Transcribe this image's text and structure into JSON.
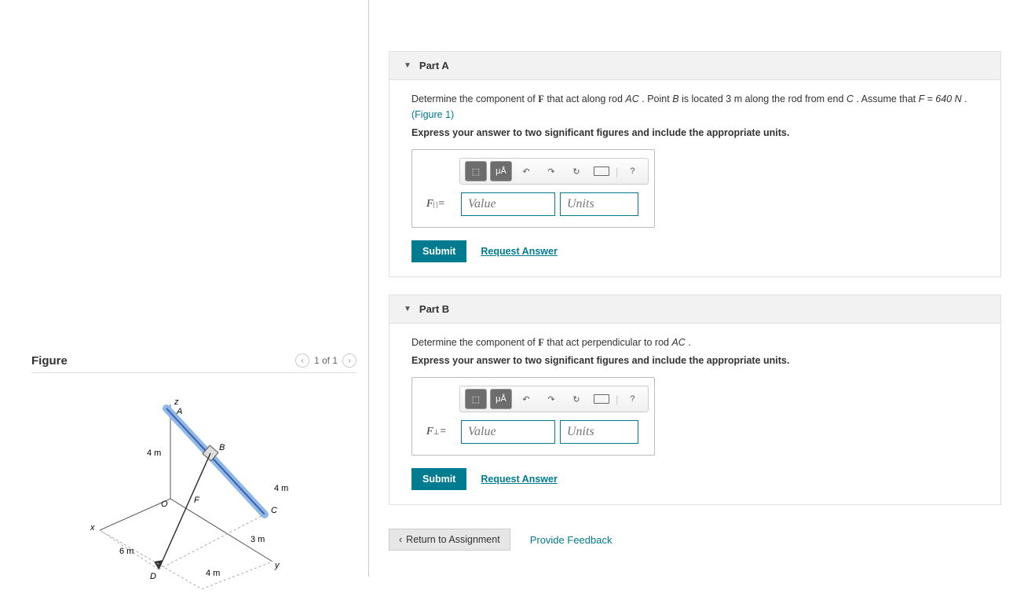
{
  "figure": {
    "title": "Figure",
    "nav_text": "1 of 1",
    "labels": {
      "A": "A",
      "B": "B",
      "C": "C",
      "D": "D",
      "O": "O",
      "F": "F",
      "x": "x",
      "y": "y",
      "z": "z",
      "dim_4m_a": "4 m",
      "dim_4m_b": "4 m",
      "dim_4m_c": "4 m",
      "dim_6m": "6 m",
      "dim_3m": "3 m"
    }
  },
  "partA": {
    "title": "Part A",
    "question_prefix": "Determine the component of ",
    "question_mid1": " that act along rod ",
    "rod": "AC",
    "question_mid2": ". Point ",
    "pointB": "B",
    "question_mid3": " is located 3 ",
    "unit_m": "m",
    "question_mid4": " along the rod from end ",
    "pointC": "C",
    "question_mid5": ". Assume that ",
    "Fval": "F = 640 N",
    "question_end": " .",
    "fig_link": "(Figure 1)",
    "instruction": "Express your answer to two significant figures and include the appropriate units.",
    "var_label": "F",
    "var_sub": "| |",
    "equals": " = ",
    "value_ph": "Value",
    "units_ph": "Units",
    "submit": "Submit",
    "request": "Request Answer",
    "toolbar": {
      "templates": "⬚",
      "mu": "μÅ",
      "undo": "↶",
      "redo": "↷",
      "reset": "↻",
      "help": "?"
    }
  },
  "partB": {
    "title": "Part B",
    "question_prefix": "Determine the component of ",
    "question_mid1": " that act perpendicular to rod ",
    "rod": "AC",
    "question_end": ".",
    "instruction": "Express your answer to two significant figures and include the appropriate units.",
    "var_label": "F",
    "var_sub": "⊥",
    "equals": " = ",
    "value_ph": "Value",
    "units_ph": "Units",
    "submit": "Submit",
    "request": "Request Answer",
    "toolbar": {
      "templates": "⬚",
      "mu": "μÅ",
      "undo": "↶",
      "redo": "↷",
      "reset": "↻",
      "help": "?"
    }
  },
  "bottom": {
    "return": "Return to Assignment",
    "feedback": "Provide Feedback"
  }
}
